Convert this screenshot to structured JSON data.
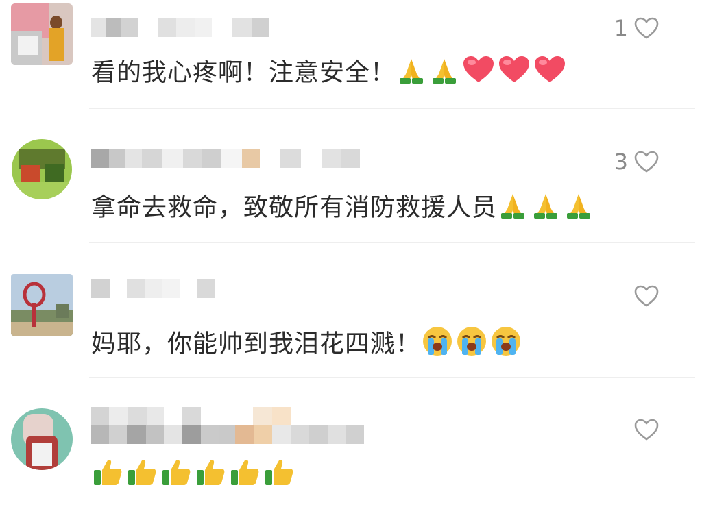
{
  "comments": [
    {
      "avatar": "landscape-person-avatar",
      "text": "看的我心疼啊！注意安全！",
      "emojis": [
        "folded-hands",
        "folded-hands",
        "red-heart",
        "red-heart",
        "red-heart"
      ],
      "likes": "1"
    },
    {
      "avatar": "green-sign-avatar",
      "text": "拿命去救命，致敬所有消防救援人员",
      "emojis": [
        "folded-hands",
        "folded-hands",
        "folded-hands"
      ],
      "likes": "3"
    },
    {
      "avatar": "statue-avatar",
      "text": "妈耶，你能帅到我泪花四溅！",
      "emojis": [
        "loudly-crying-face",
        "loudly-crying-face",
        "loudly-crying-face"
      ],
      "likes": ""
    },
    {
      "avatar": "child-photo-avatar",
      "text": "",
      "emojis": [
        "thumbs-up",
        "thumbs-up",
        "thumbs-up",
        "thumbs-up",
        "thumbs-up",
        "thumbs-up"
      ],
      "likes": ""
    }
  ],
  "colors": {
    "heart_outline": "#9a9a9a",
    "like_count": "#8a8a8a",
    "divider": "#eeeeee"
  }
}
